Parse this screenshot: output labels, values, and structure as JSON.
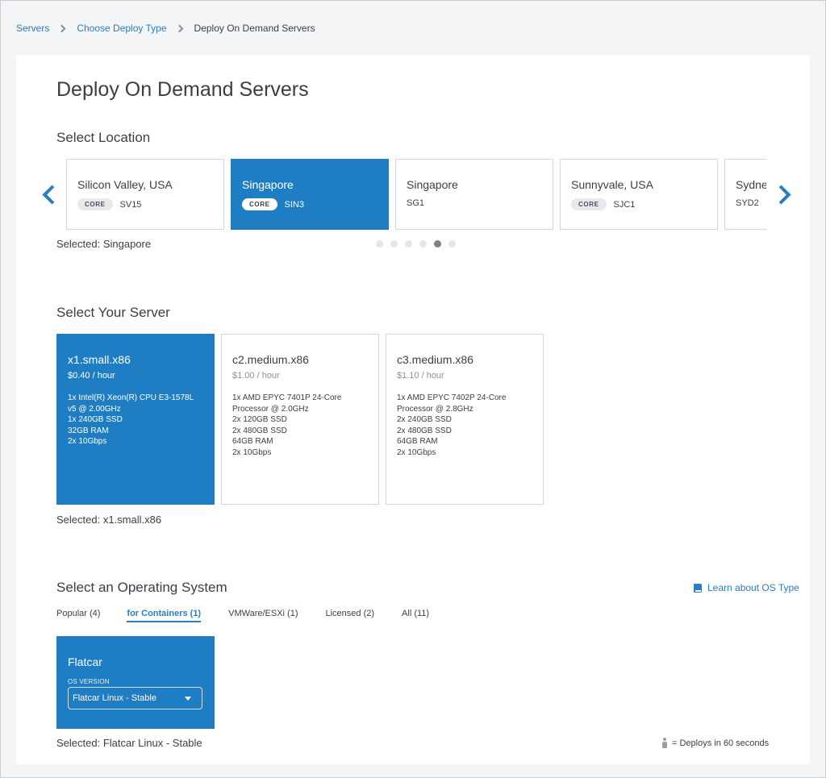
{
  "breadcrumb": {
    "items": [
      {
        "label": "Servers"
      },
      {
        "label": "Choose Deploy Type"
      }
    ],
    "current": "Deploy On Demand Servers"
  },
  "page": {
    "title": "Deploy On Demand Servers"
  },
  "location": {
    "section_title": "Select Location",
    "cards": [
      {
        "name": "Silicon Valley, USA",
        "badge": "CORE",
        "code": "SV15",
        "selected": false
      },
      {
        "name": "Singapore",
        "badge": "CORE",
        "code": "SIN3",
        "selected": true
      },
      {
        "name": "Singapore",
        "badge": "",
        "code": "SG1",
        "selected": false
      },
      {
        "name": "Sunnyvale, USA",
        "badge": "CORE",
        "code": "SJC1",
        "selected": false
      },
      {
        "name": "Sydney",
        "badge": "",
        "code": "SYD2",
        "selected": false
      }
    ],
    "selected_text": "Selected: Singapore",
    "pagination": {
      "count": 6,
      "active_index": 4
    }
  },
  "server": {
    "section_title": "Select Your Server",
    "cards": [
      {
        "name": "x1.small.x86",
        "price": "$0.40 / hour",
        "specs": [
          "1x Intel(R) Xeon(R) CPU E3-1578L",
          "v5 @ 2.00GHz",
          "1x 240GB SSD",
          "32GB RAM",
          "2x 10Gbps"
        ],
        "selected": true
      },
      {
        "name": "c2.medium.x86",
        "price": "$1.00 / hour",
        "specs": [
          "1x AMD EPYC 7401P 24-Core",
          "Processor @ 2.0GHz",
          "2x 120GB SSD",
          "2x 480GB SSD",
          "64GB RAM",
          "2x 10Gbps"
        ],
        "selected": false
      },
      {
        "name": "c3.medium.x86",
        "price": "$1.10 / hour",
        "specs": [
          "1x AMD EPYC 7402P 24-Core",
          "Processor @ 2.8GHz",
          "2x 240GB SSD",
          "2x 480GB SSD",
          "64GB RAM",
          "2x 10Gbps"
        ],
        "selected": false
      }
    ],
    "selected_text": "Selected: x1.small.x86"
  },
  "os": {
    "section_title": "Select an Operating System",
    "learn_link": "Learn about OS Type",
    "tabs": [
      {
        "label": "Popular (4)",
        "active": false
      },
      {
        "label": "for Containers (1)",
        "active": true
      },
      {
        "label": "VMWare/ESXi (1)",
        "active": false
      },
      {
        "label": "Licensed (2)",
        "active": false
      },
      {
        "label": "All (11)",
        "active": false
      }
    ],
    "card": {
      "name": "Flatcar",
      "version_label": "OS VERSION",
      "version_value": "Flatcar Linux - Stable"
    },
    "selected_text": "Selected: Flatcar Linux - Stable",
    "deploy_note": "= Deploys in 60 seconds"
  },
  "colors": {
    "accent": "#1f7ec3",
    "link": "#2a7dc0"
  }
}
